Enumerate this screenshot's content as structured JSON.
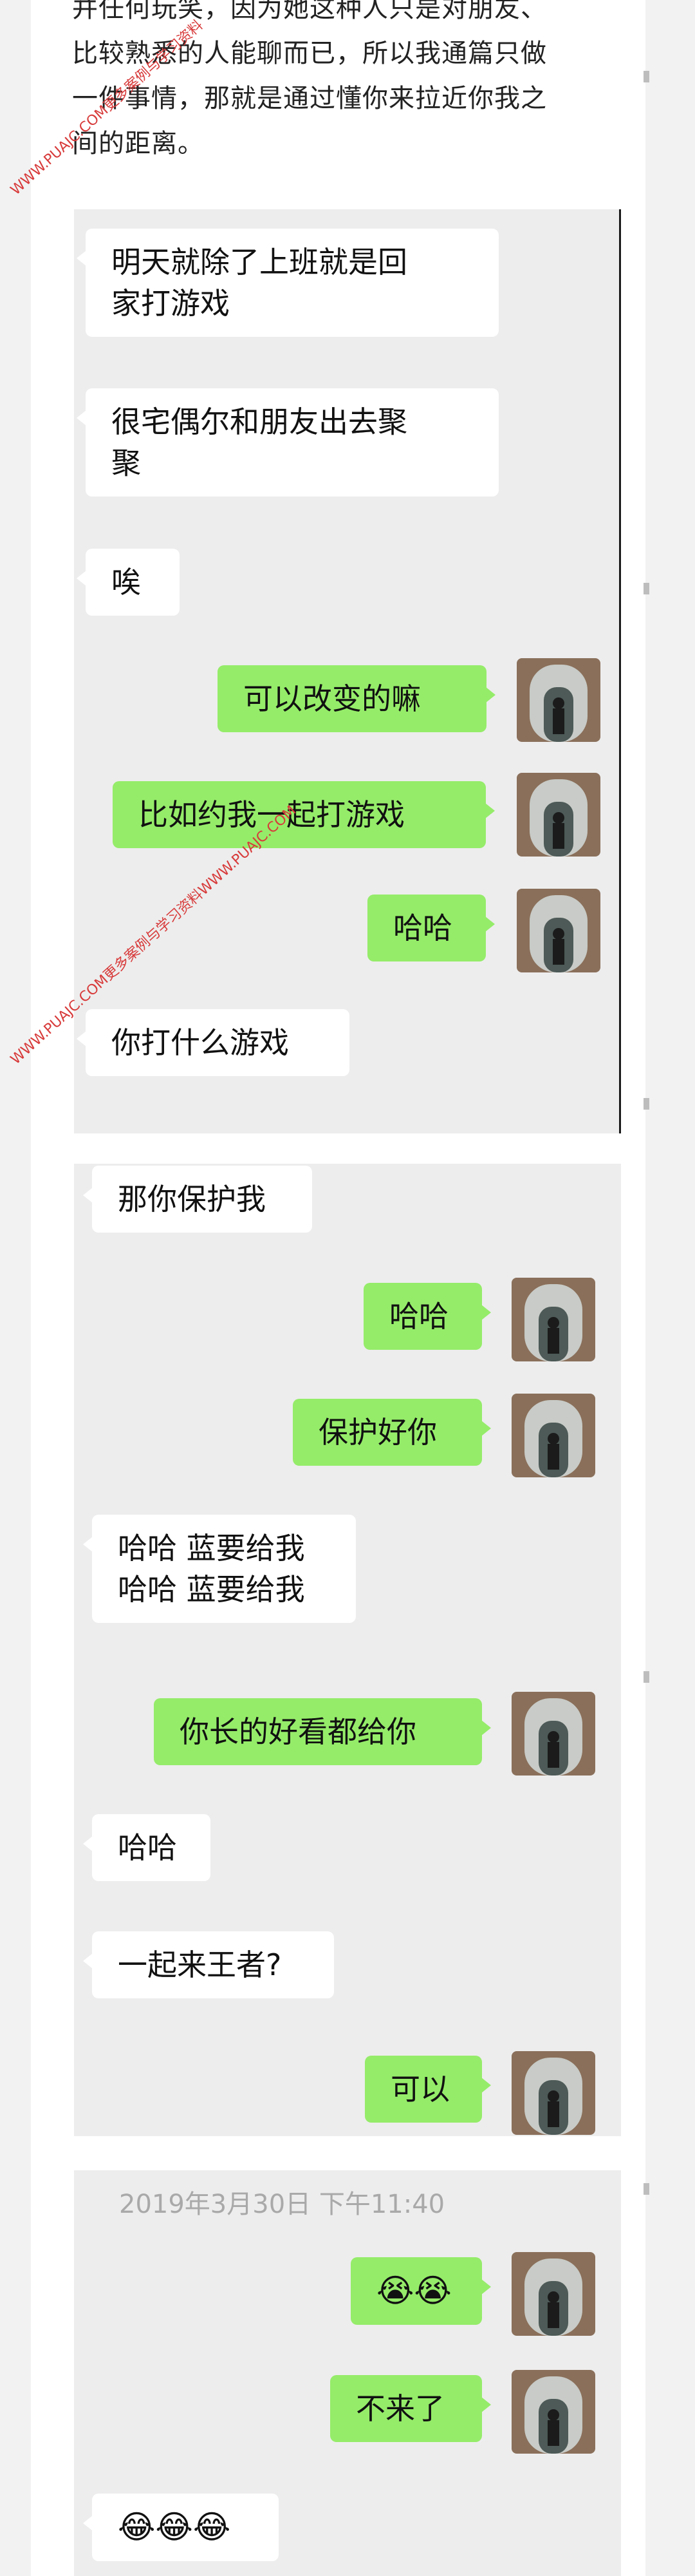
{
  "intro": {
    "lines": [
      "并任何玩笑，因为她这种人只是对朋友、",
      "比较熟悉的人能聊而已，所以我通篇只做",
      "一件事情，那就是通过懂你来拉近你我之",
      "间的距离。"
    ]
  },
  "chat1": [
    {
      "side": "left",
      "text": "明天就除了上班就是回\n家打游戏"
    },
    {
      "side": "left",
      "text": "很宅偶尔和朋友出去聚\n聚"
    },
    {
      "side": "left",
      "text": "唉"
    },
    {
      "side": "right",
      "text": "可以改变的嘛"
    },
    {
      "side": "right",
      "text": "比如约我一起打游戏"
    },
    {
      "side": "right",
      "text": "哈哈"
    },
    {
      "side": "left",
      "text": "你打什么游戏"
    }
  ],
  "chat2": [
    {
      "side": "left",
      "text": "那你保护我"
    },
    {
      "side": "right",
      "text": "哈哈"
    },
    {
      "side": "right",
      "text": "保护好你"
    },
    {
      "side": "left",
      "text": "哈哈 蓝要给我\n哈哈 蓝要给我"
    },
    {
      "side": "right",
      "text": "你长的好看都给你"
    },
    {
      "side": "left",
      "text": "哈哈"
    },
    {
      "side": "left",
      "text": "一起来王者?"
    },
    {
      "side": "right",
      "text": "可以"
    }
  ],
  "chat3": {
    "timestamp": "2019年3月30日 下午11:40",
    "messages": [
      {
        "side": "right",
        "text": "😭😭"
      },
      {
        "side": "right",
        "text": "不来了"
      },
      {
        "side": "left",
        "text": "😂😂😂"
      }
    ]
  },
  "watermarks": [
    "WWW.PUAJC.COM更多案例与学习资料",
    "WWW.PUAJC.COM更多案例与学习资料WWW.PUAJC.COM"
  ],
  "colors": {
    "sent_bubble": "#95ec69",
    "received_bubble": "#ffffff",
    "chat_background": "#ededed",
    "watermark": "#d83a3a"
  }
}
